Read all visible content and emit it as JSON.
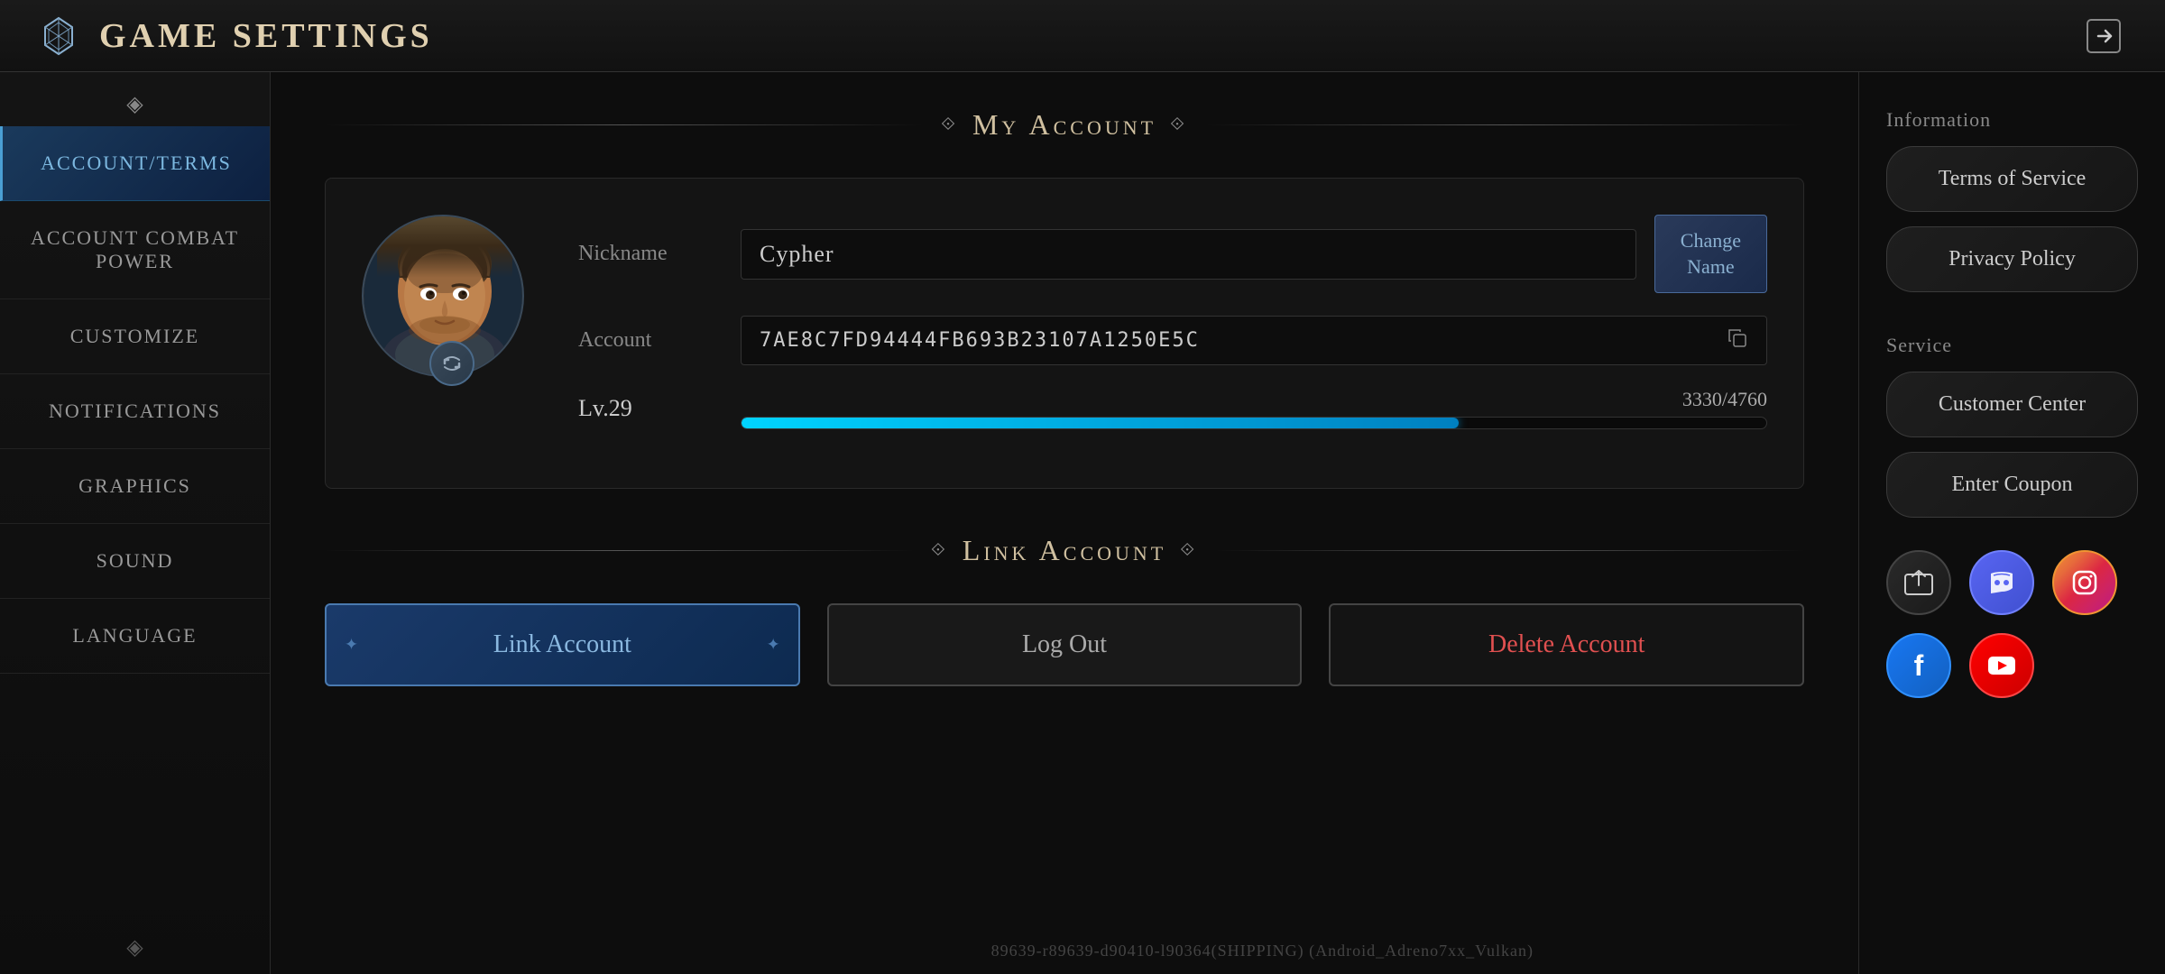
{
  "header": {
    "title": "Game Settings",
    "logo_alt": "game-logo"
  },
  "sidebar": {
    "deco_top": "◈",
    "deco_bottom": "◈",
    "items": [
      {
        "id": "account-terms",
        "label": "Account/Terms",
        "active": true
      },
      {
        "id": "account-combat-power",
        "label": "Account Combat Power",
        "active": false
      },
      {
        "id": "customize",
        "label": "Customize",
        "active": false
      },
      {
        "id": "notifications",
        "label": "Notifications",
        "active": false
      },
      {
        "id": "graphics",
        "label": "Graphics",
        "active": false
      },
      {
        "id": "sound",
        "label": "Sound",
        "active": false
      },
      {
        "id": "language",
        "label": "Language",
        "active": false
      }
    ]
  },
  "main": {
    "my_account_section": {
      "title": "My Account",
      "nickname_label": "Nickname",
      "nickname_value": "Cypher",
      "change_name_label": "Change\nName",
      "account_label": "Account",
      "account_value": "7AE8C7FD94444FB693B23107A1250E5C",
      "level_label": "Lv.29",
      "level_current": 3330,
      "level_max": 4760,
      "level_percent": 70
    },
    "link_account_section": {
      "title": "Link Account",
      "link_button_label": "Link Account",
      "logout_button_label": "Log Out",
      "delete_button_label": "Delete Account"
    }
  },
  "right_panel": {
    "information_label": "Information",
    "terms_of_service_label": "Terms of Service",
    "privacy_policy_label": "Privacy Policy",
    "service_label": "Service",
    "customer_center_label": "Customer Center",
    "enter_coupon_label": "Enter Coupon",
    "social_icons": [
      {
        "id": "share",
        "label": "share-icon",
        "symbol": "⬆"
      },
      {
        "id": "discord",
        "label": "discord-icon",
        "symbol": "💬"
      },
      {
        "id": "instagram",
        "label": "instagram-icon",
        "symbol": "📷"
      },
      {
        "id": "facebook",
        "label": "facebook-icon",
        "symbol": "f"
      },
      {
        "id": "youtube",
        "label": "youtube-icon",
        "symbol": "▶"
      }
    ]
  },
  "footer": {
    "build_info": "89639-r89639-d90410-l90364(SHIPPING)   (Android_Adreno7xx_Vulkan)"
  }
}
